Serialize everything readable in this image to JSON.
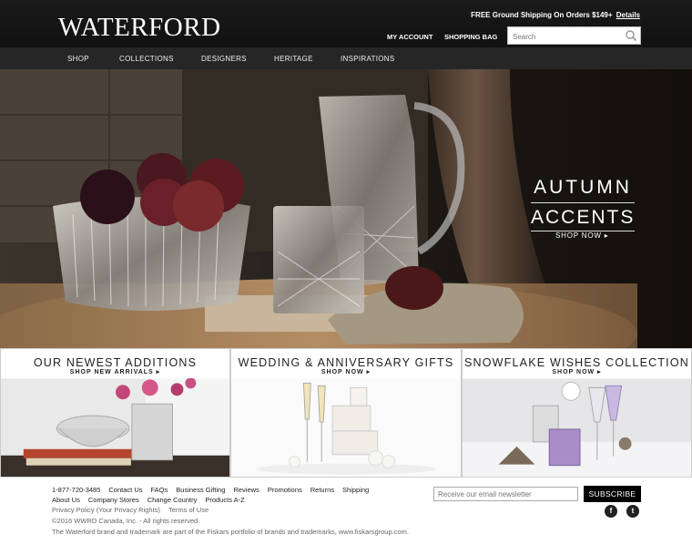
{
  "header": {
    "logo": "WATERFORD",
    "promo": "FREE Ground Shipping On Orders $149+",
    "promo_link": "Details",
    "my_account": "MY ACCOUNT",
    "shopping_bag": "SHOPPING BAG",
    "search_placeholder": "Search"
  },
  "nav": {
    "items": [
      "SHOP",
      "COLLECTIONS",
      "DESIGNERS",
      "HERITAGE",
      "INSPIRATIONS"
    ]
  },
  "hero": {
    "line1": "AUTUMN",
    "line2": "ACCENTS",
    "cta": "SHOP NOW ▸"
  },
  "tiles": [
    {
      "title": "OUR NEWEST ADDITIONS",
      "cta": "SHOP NEW ARRIVALS ▸"
    },
    {
      "title": "WEDDING & ANNIVERSARY GIFTS",
      "cta": "SHOP NOW ▸"
    },
    {
      "title": "SNOWFLAKE WISHES COLLECTION",
      "cta": "SHOP NOW ▸"
    }
  ],
  "footer": {
    "links_row1": [
      "1-877-720-3485",
      "Contact Us",
      "FAQs",
      "Business Gifting",
      "Reviews",
      "Promotions",
      "Returns",
      "Shipping"
    ],
    "links_row2": [
      "About Us",
      "Company Stores",
      "Change Country",
      "Products A-Z"
    ],
    "links_row3": [
      "Privacy Policy (Your Privacy Rights)",
      "Terms of Use"
    ],
    "copyright": "©2016 WWRD Canada, Inc. - All rights reserved.",
    "brand_note": "The Waterford brand and trademark are part of the Fiskars portfolio of brands and trademarks, www.fiskarsgroup.com.",
    "newsletter_placeholder": "Receive our email newsletter",
    "subscribe": "SUBSCRIBE",
    "facebook_glyph": "f",
    "twitter_glyph": "t"
  }
}
